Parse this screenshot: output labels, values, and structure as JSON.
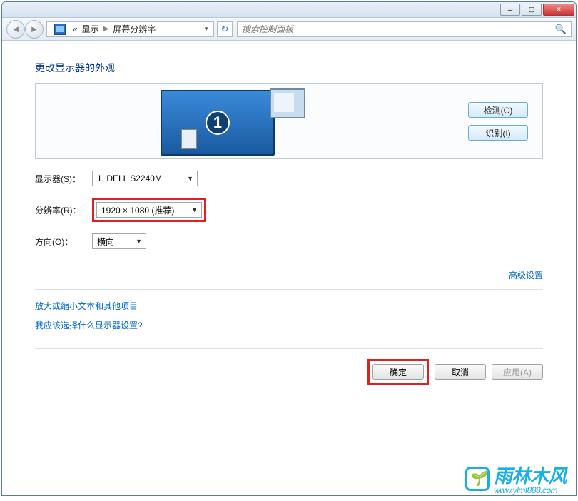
{
  "titlebar": {},
  "breadcrumb": {
    "back": "«",
    "item1": "显示",
    "item2": "屏幕分辨率"
  },
  "search": {
    "placeholder": "搜索控制面板"
  },
  "content": {
    "heading": "更改显示器的外观",
    "monitor_number": "1",
    "detect_btn": "检测(C)",
    "identify_btn": "识别(I)",
    "display_label": "显示器(S)：",
    "display_value": "1. DELL S2240M",
    "resolution_label": "分辨率(R)：",
    "resolution_value": "1920 × 1080 (推荐)",
    "orientation_label": "方向(O)：",
    "orientation_value": "横向",
    "advanced_link": "高级设置",
    "link1": "放大或缩小文本和其他项目",
    "link2": "我应该选择什么显示器设置?",
    "ok_btn": "确定",
    "cancel_btn": "取消",
    "apply_btn": "应用(A)"
  },
  "watermark": {
    "text": "雨林木风",
    "url": "www.ylmf888.com"
  }
}
